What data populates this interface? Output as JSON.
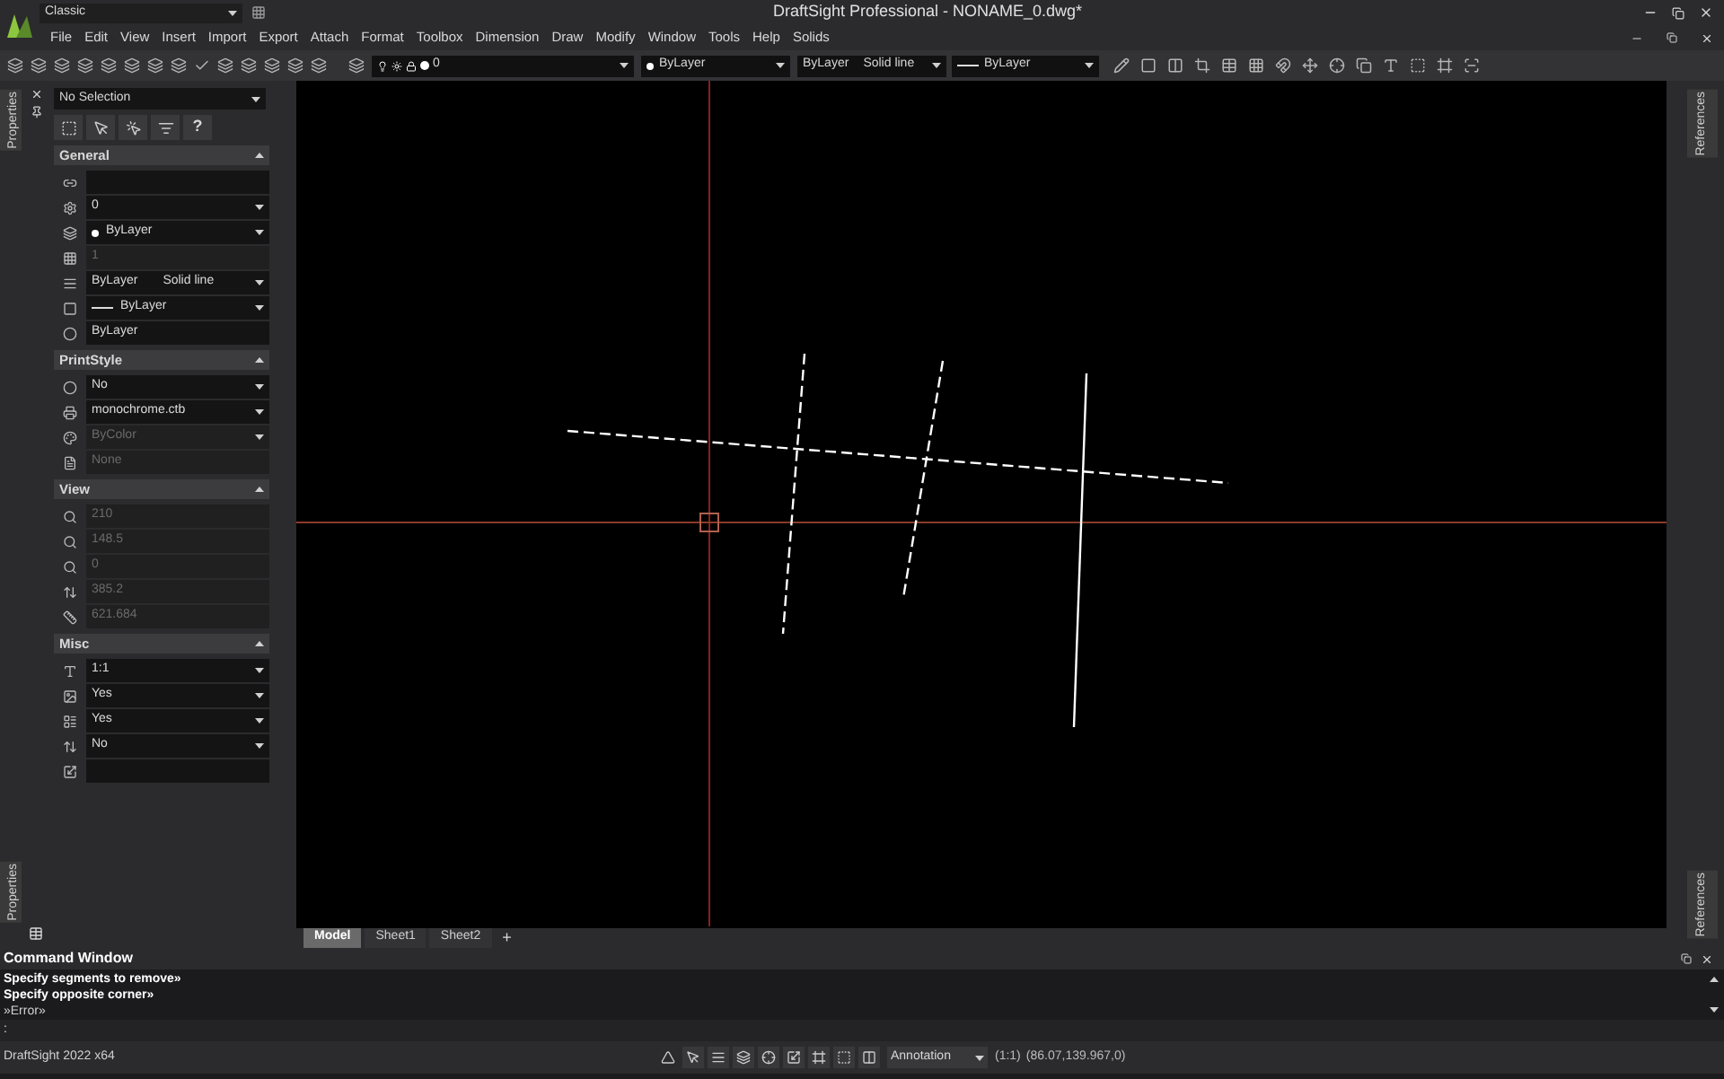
{
  "app": {
    "workspace": "Classic",
    "title": "DraftSight Professional - NONAME_0.dwg*"
  },
  "menu": [
    "File",
    "Edit",
    "View",
    "Insert",
    "Import",
    "Export",
    "Attach",
    "Format",
    "Toolbox",
    "Dimension",
    "Draw",
    "Modify",
    "Window",
    "Tools",
    "Help",
    "Solids"
  ],
  "toolbar": {
    "layer": "0",
    "color_setting": "ByLayer",
    "linestyle": "ByLayer",
    "linestyle_name": "Solid line",
    "lineweight": "ByLayer"
  },
  "side_tabs_left": [
    "Properties",
    "Properties"
  ],
  "side_tabs_right": [
    "References",
    "References"
  ],
  "properties": {
    "selection": "No Selection",
    "help": "?",
    "sections": [
      {
        "title": "General",
        "expanded": true,
        "rows": [
          {
            "kind": "text",
            "dropdown": false,
            "disabled": false
          },
          {
            "kind": "text",
            "value": "0",
            "dropdown": true,
            "disabled": false
          },
          {
            "kind": "dot",
            "value": "ByLayer",
            "dropdown": true,
            "disabled": false
          },
          {
            "kind": "text",
            "value": "1",
            "dropdown": false,
            "disabled": true
          },
          {
            "kind": "pair",
            "value": "ByLayer",
            "value2": "Solid line",
            "dropdown": true,
            "disabled": false
          },
          {
            "kind": "line",
            "value": "ByLayer",
            "dropdown": true,
            "disabled": false
          },
          {
            "kind": "text",
            "value": "ByLayer",
            "dropdown": false,
            "disabled": false
          }
        ]
      },
      {
        "title": "PrintStyle",
        "expanded": true,
        "rows": [
          {
            "kind": "text",
            "value": "No",
            "dropdown": true,
            "disabled": false
          },
          {
            "kind": "text",
            "value": "monochrome.ctb",
            "dropdown": true,
            "disabled": false
          },
          {
            "kind": "text",
            "value": "ByColor",
            "dropdown": true,
            "disabled": true
          },
          {
            "kind": "text",
            "value": "None",
            "dropdown": false,
            "disabled": true
          }
        ]
      },
      {
        "title": "View",
        "expanded": true,
        "rows": [
          {
            "kind": "text",
            "value": "210",
            "dropdown": false,
            "disabled": true
          },
          {
            "kind": "text",
            "value": "148.5",
            "dropdown": false,
            "disabled": true
          },
          {
            "kind": "text",
            "value": "0",
            "dropdown": false,
            "disabled": true
          },
          {
            "kind": "text",
            "value": "385.2",
            "dropdown": false,
            "disabled": true
          },
          {
            "kind": "text",
            "value": "621.684",
            "dropdown": false,
            "disabled": true
          }
        ]
      },
      {
        "title": "Misc",
        "expanded": true,
        "rows": [
          {
            "kind": "text",
            "value": "1:1",
            "dropdown": true,
            "disabled": false
          },
          {
            "kind": "text",
            "value": "Yes",
            "dropdown": true,
            "disabled": false
          },
          {
            "kind": "text",
            "value": "Yes",
            "dropdown": true,
            "disabled": false
          },
          {
            "kind": "text",
            "value": "No",
            "dropdown": true,
            "disabled": false
          },
          {
            "kind": "text",
            "dropdown": false,
            "disabled": false
          }
        ]
      }
    ]
  },
  "sheet_tabs": [
    {
      "label": "Model",
      "selected": true
    },
    {
      "label": "Sheet1",
      "selected": false
    },
    {
      "label": "Sheet2",
      "selected": false
    }
  ],
  "add_tab": "+",
  "command_window": {
    "title": "Command Window",
    "lines": [
      "Specify segments to remove»",
      "Specify opposite corner»",
      "»Error»"
    ],
    "prompt": ":"
  },
  "status_bar": {
    "app": "DraftSight 2022 x64",
    "annotation": "Annotation",
    "scale": "(1:1)",
    "coords": "(86.07,139.967,0)"
  }
}
